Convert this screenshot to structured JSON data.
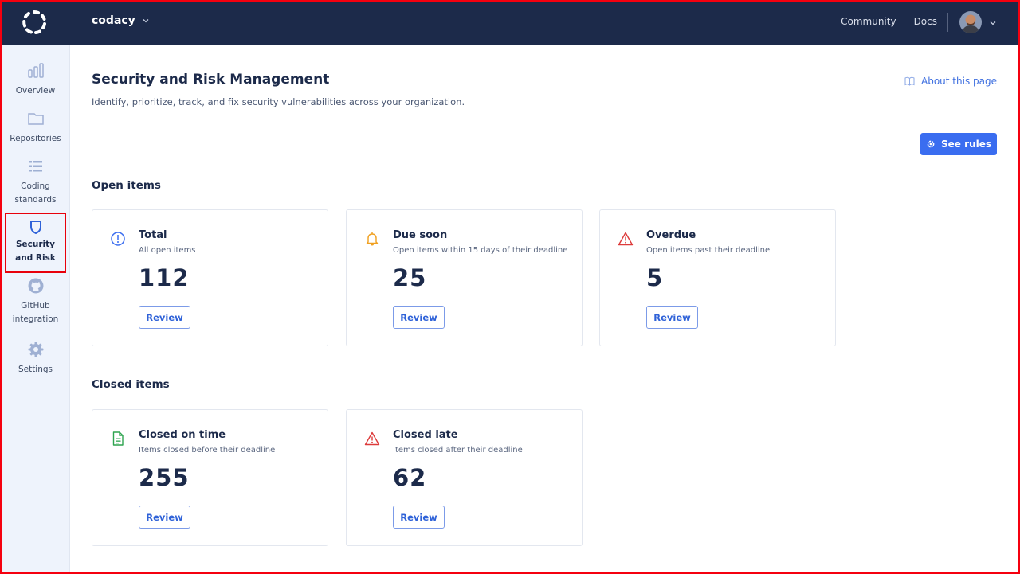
{
  "topbar": {
    "org_name": "codacy",
    "links": [
      {
        "label": "Community"
      },
      {
        "label": "Docs"
      }
    ]
  },
  "sidebar": {
    "items": [
      {
        "label": "Overview",
        "icon": "bar-chart-icon"
      },
      {
        "label": "Repositories",
        "icon": "folder-icon"
      },
      {
        "label": "Coding standards",
        "icon": "list-icon"
      },
      {
        "label": "Security and Risk",
        "icon": "shield-icon",
        "active": true
      },
      {
        "label": "GitHub integration",
        "icon": "github-icon"
      },
      {
        "label": "Settings",
        "icon": "gear-icon"
      }
    ]
  },
  "page": {
    "title": "Security and Risk Management",
    "subtitle": "Identify, prioritize, track, and fix security vulnerabilities across your organization.",
    "about_label": "About this page",
    "see_rules_label": "See rules"
  },
  "open_items": {
    "heading": "Open items",
    "cards": [
      {
        "title": "Total",
        "description": "All open items",
        "count": "112",
        "button": "Review",
        "icon": "info-circle-icon",
        "color": "#3a6df0"
      },
      {
        "title": "Due soon",
        "description": "Open items within 15 days of their deadline",
        "count": "25",
        "button": "Review",
        "icon": "bell-icon",
        "color": "#f0a020"
      },
      {
        "title": "Overdue",
        "description": "Open items past their deadline",
        "count": "5",
        "button": "Review",
        "icon": "warning-triangle-icon",
        "color": "#dd3b3b"
      }
    ]
  },
  "closed_items": {
    "heading": "Closed items",
    "cards": [
      {
        "title": "Closed on time",
        "description": "Items closed before their deadline",
        "count": "255",
        "button": "Review",
        "icon": "document-icon",
        "color": "#2ea44f"
      },
      {
        "title": "Closed late",
        "description": "Items closed after their deadline",
        "count": "62",
        "button": "Review",
        "icon": "warning-triangle-icon",
        "color": "#dd3b3b"
      }
    ]
  },
  "colors": {
    "topbar": "#1c2a4a",
    "sidebar": "#eef3fc",
    "accent": "#3a6df0",
    "highlight_border": "#e8000b"
  }
}
